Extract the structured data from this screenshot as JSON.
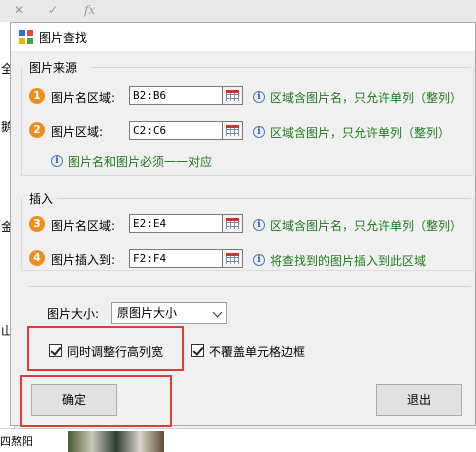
{
  "background": {
    "formula_fx": "fx",
    "left_chars": [
      "全",
      "鹅",
      "金",
      "山"
    ],
    "bottom_label": "四熬阳"
  },
  "dialog": {
    "title": "图片查找",
    "source_group": {
      "label": "图片来源",
      "rows": [
        {
          "num": "1",
          "label": "图片名区域:",
          "value": "B2:B6",
          "hint": "区域含图片名，只允许单列（整列）"
        },
        {
          "num": "2",
          "label": "图片区域:",
          "value": "C2:C6",
          "hint": "区域含图片，只允许单列（整列）"
        }
      ],
      "note": "图片名和图片必须一一对应"
    },
    "insert_group": {
      "label": "插入",
      "rows": [
        {
          "num": "3",
          "label": "图片名区域:",
          "value": "E2:E4",
          "hint": "区域含图片名，只允许单列（整列）"
        },
        {
          "num": "4",
          "label": "图片插入到:",
          "value": "F2:F4",
          "hint": "将查找到的图片插入到此区域"
        }
      ]
    },
    "size": {
      "label": "图片大小:",
      "selected": "原图片大小"
    },
    "options": {
      "adjust_row_col": "同时调整行高列宽",
      "keep_border": "不覆盖单元格边框"
    },
    "buttons": {
      "ok": "确定",
      "exit": "退出"
    }
  },
  "colors": {
    "badge": "#f08d1e",
    "hint_text": "#1c7a1c",
    "highlight": "#e23a3a"
  }
}
